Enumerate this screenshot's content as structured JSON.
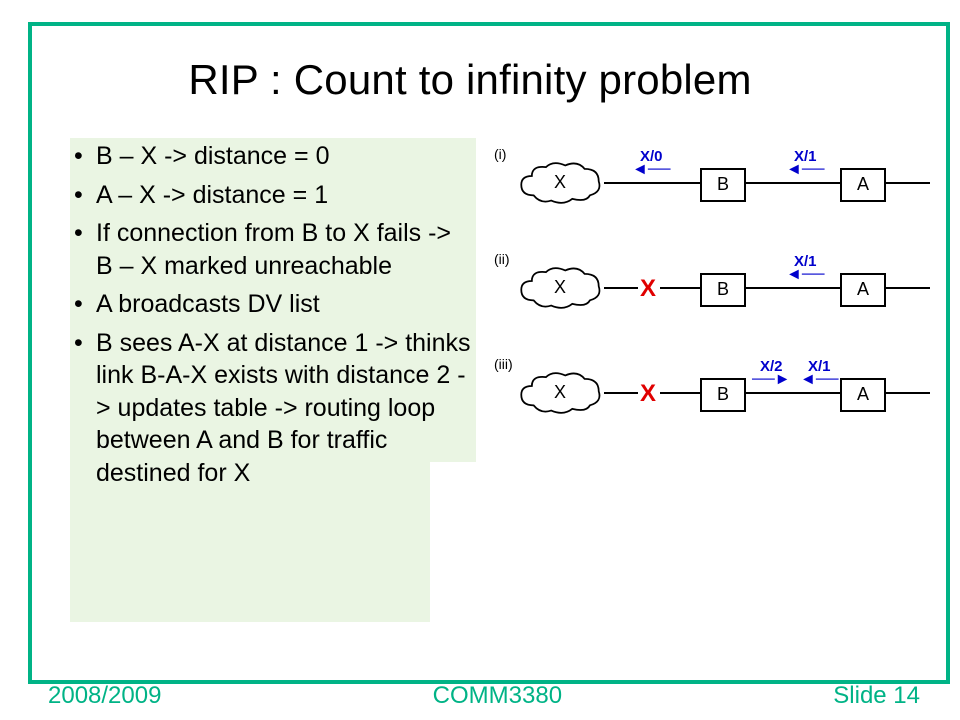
{
  "title": "RIP : Count to infinity problem",
  "bullets": [
    "B – X -> distance = 0",
    "A – X -> distance = 1",
    "If connection from B to X fails -> B – X marked unreachable",
    "A  broadcasts DV list",
    "B sees A-X at distance 1 -> thinks link B-A-X exists with distance 2 -> updates table -> routing loop between A and B for traffic destined for X"
  ],
  "diagram": {
    "rows": [
      {
        "rn": "(i)",
        "nodeX": "X",
        "nodeB": "B",
        "nodeA": "A",
        "labelBX": "X/0",
        "dirBX": "left",
        "labelAB": "X/1",
        "dirAB": "left",
        "broken": false
      },
      {
        "rn": "(ii)",
        "nodeX": "X",
        "nodeB": "B",
        "nodeA": "A",
        "labelBX": "",
        "dirBX": "",
        "labelAB": "X/1",
        "dirAB": "left",
        "broken": true
      },
      {
        "rn": "(iii)",
        "nodeX": "X",
        "nodeB": "B",
        "nodeA": "A",
        "labelBX": "X/2",
        "dirBX": "right",
        "labelAB": "X/1",
        "dirAB": "left",
        "broken": true,
        "labelBX_between": "BA"
      }
    ]
  },
  "footer": {
    "left": "2008/2009",
    "center": "COMM3380",
    "right": "Slide 14"
  }
}
